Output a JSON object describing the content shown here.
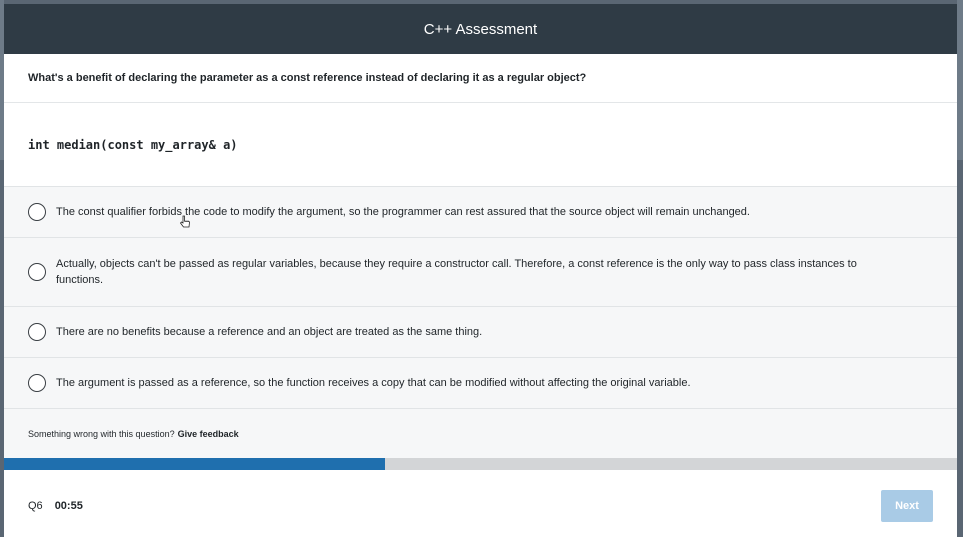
{
  "header": {
    "title": "C++ Assessment"
  },
  "question": {
    "text": "What's a benefit of declaring the parameter as a const reference instead of declaring it as a regular object?",
    "code": "int median(const my_array& a)"
  },
  "options": [
    {
      "text": "The const qualifier forbids the code to modify the argument, so the programmer can rest assured that the source object will remain unchanged."
    },
    {
      "text": "Actually, objects can't be passed as regular variables, because they require a constructor call. Therefore, a const reference is the only way to pass class instances to functions."
    },
    {
      "text": "There are no benefits because a reference and an object are treated as the same thing."
    },
    {
      "text": "The argument is passed as a reference, so the function receives a copy that can be modified without affecting the original variable."
    }
  ],
  "feedback": {
    "prompt": "Something wrong with this question?",
    "link": "Give feedback"
  },
  "progress": {
    "fraction": 0.4
  },
  "footer": {
    "question_number": "Q6",
    "timer": "00:55",
    "next_label": "Next"
  },
  "colors": {
    "header_bg": "#2f3b45",
    "progress_fill": "#1f6fae",
    "next_disabled": "#a9cbe6"
  }
}
